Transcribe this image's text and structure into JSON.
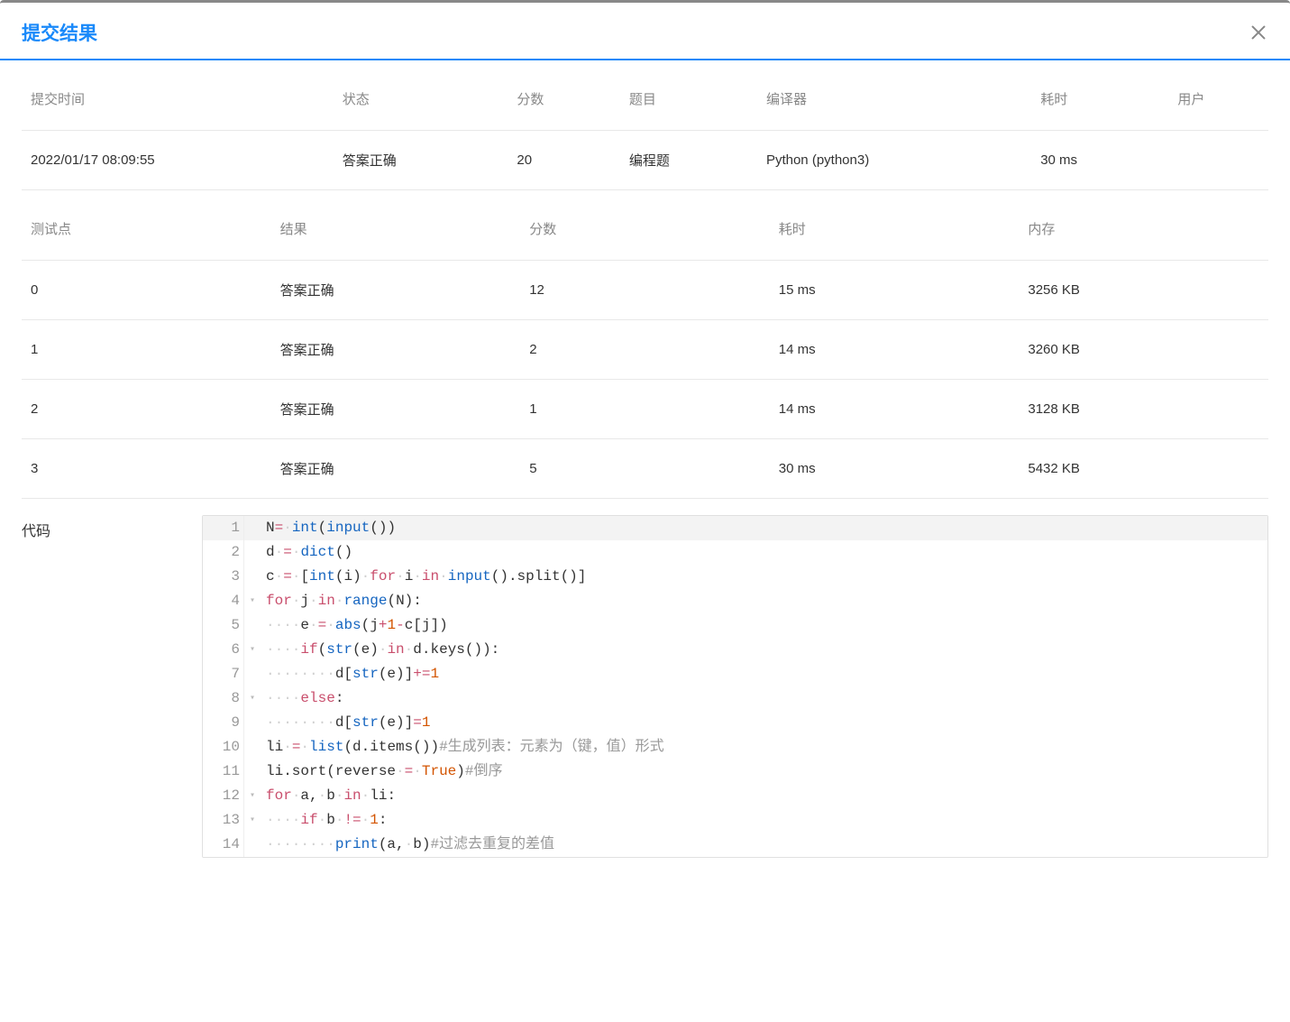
{
  "modal": {
    "title": "提交结果",
    "close_label": "关闭"
  },
  "summary_table": {
    "headers": {
      "submit_time": "提交时间",
      "status": "状态",
      "score": "分数",
      "problem": "题目",
      "compiler": "编译器",
      "time": "耗时",
      "user": "用户"
    },
    "row": {
      "submit_time": "2022/01/17 08:09:55",
      "status": "答案正确",
      "score": "20",
      "problem": "编程题",
      "compiler": "Python (python3)",
      "time": "30 ms",
      "user": ""
    }
  },
  "testpoint_table": {
    "headers": {
      "testpoint": "测试点",
      "result": "结果",
      "score": "分数",
      "time": "耗时",
      "memory": "内存"
    },
    "rows": [
      {
        "testpoint": "0",
        "result": "答案正确",
        "score": "12",
        "time": "15 ms",
        "memory": "3256 KB"
      },
      {
        "testpoint": "1",
        "result": "答案正确",
        "score": "2",
        "time": "14 ms",
        "memory": "3260 KB"
      },
      {
        "testpoint": "2",
        "result": "答案正确",
        "score": "1",
        "time": "14 ms",
        "memory": "3128 KB"
      },
      {
        "testpoint": "3",
        "result": "答案正确",
        "score": "5",
        "time": "30 ms",
        "memory": "5432 KB"
      }
    ]
  },
  "code_section": {
    "label": "代码",
    "lines": [
      {
        "n": 1,
        "fold": "",
        "indent": 0,
        "tokens": [
          [
            "id",
            "N"
          ],
          [
            "op",
            "="
          ],
          [
            "ws",
            "·"
          ],
          [
            "fn",
            "int"
          ],
          [
            "id",
            "("
          ],
          [
            "fn",
            "input"
          ],
          [
            "id",
            "())"
          ]
        ]
      },
      {
        "n": 2,
        "fold": "",
        "indent": 0,
        "tokens": [
          [
            "id",
            "d"
          ],
          [
            "ws",
            "·"
          ],
          [
            "op",
            "="
          ],
          [
            "ws",
            "·"
          ],
          [
            "fn",
            "dict"
          ],
          [
            "id",
            "()"
          ]
        ]
      },
      {
        "n": 3,
        "fold": "",
        "indent": 0,
        "tokens": [
          [
            "id",
            "c"
          ],
          [
            "ws",
            "·"
          ],
          [
            "op",
            "="
          ],
          [
            "ws",
            "·"
          ],
          [
            "id",
            "["
          ],
          [
            "fn",
            "int"
          ],
          [
            "id",
            "(i)"
          ],
          [
            "ws",
            "·"
          ],
          [
            "kw",
            "for"
          ],
          [
            "ws",
            "·"
          ],
          [
            "id",
            "i"
          ],
          [
            "ws",
            "·"
          ],
          [
            "kw",
            "in"
          ],
          [
            "ws",
            "·"
          ],
          [
            "fn",
            "input"
          ],
          [
            "id",
            "().split()]"
          ]
        ]
      },
      {
        "n": 4,
        "fold": "▾",
        "indent": 0,
        "tokens": [
          [
            "kw",
            "for"
          ],
          [
            "ws",
            "·"
          ],
          [
            "id",
            "j"
          ],
          [
            "ws",
            "·"
          ],
          [
            "kw",
            "in"
          ],
          [
            "ws",
            "·"
          ],
          [
            "fn",
            "range"
          ],
          [
            "id",
            "(N):"
          ]
        ]
      },
      {
        "n": 5,
        "fold": "",
        "indent": 1,
        "tokens": [
          [
            "id",
            "e"
          ],
          [
            "ws",
            "·"
          ],
          [
            "op",
            "="
          ],
          [
            "ws",
            "·"
          ],
          [
            "fn",
            "abs"
          ],
          [
            "id",
            "(j"
          ],
          [
            "op",
            "+"
          ],
          [
            "num",
            "1"
          ],
          [
            "op",
            "-"
          ],
          [
            "id",
            "c[j])"
          ]
        ]
      },
      {
        "n": 6,
        "fold": "▾",
        "indent": 1,
        "tokens": [
          [
            "kw",
            "if"
          ],
          [
            "id",
            "("
          ],
          [
            "fn",
            "str"
          ],
          [
            "id",
            "(e)"
          ],
          [
            "ws",
            "·"
          ],
          [
            "kw",
            "in"
          ],
          [
            "ws",
            "·"
          ],
          [
            "id",
            "d.keys()):"
          ]
        ]
      },
      {
        "n": 7,
        "fold": "",
        "indent": 2,
        "tokens": [
          [
            "id",
            "d["
          ],
          [
            "fn",
            "str"
          ],
          [
            "id",
            "(e)]"
          ],
          [
            "op",
            "+="
          ],
          [
            "num",
            "1"
          ]
        ]
      },
      {
        "n": 8,
        "fold": "▾",
        "indent": 1,
        "tokens": [
          [
            "kw",
            "else"
          ],
          [
            "id",
            ":"
          ]
        ]
      },
      {
        "n": 9,
        "fold": "",
        "indent": 2,
        "tokens": [
          [
            "id",
            "d["
          ],
          [
            "fn",
            "str"
          ],
          [
            "id",
            "(e)]"
          ],
          [
            "op",
            "="
          ],
          [
            "num",
            "1"
          ]
        ]
      },
      {
        "n": 10,
        "fold": "",
        "indent": 0,
        "tokens": [
          [
            "id",
            "li"
          ],
          [
            "ws",
            "·"
          ],
          [
            "op",
            "="
          ],
          [
            "ws",
            "·"
          ],
          [
            "fn",
            "list"
          ],
          [
            "id",
            "(d.items())"
          ],
          [
            "cmt",
            "#生成列表：元素为（键，值）形式"
          ]
        ]
      },
      {
        "n": 11,
        "fold": "",
        "indent": 0,
        "tokens": [
          [
            "id",
            "li.sort(reverse"
          ],
          [
            "ws",
            "·"
          ],
          [
            "op",
            "="
          ],
          [
            "ws",
            "·"
          ],
          [
            "bool",
            "True"
          ],
          [
            "id",
            ")"
          ],
          [
            "cmt",
            "#倒序"
          ]
        ]
      },
      {
        "n": 12,
        "fold": "▾",
        "indent": 0,
        "tokens": [
          [
            "kw",
            "for"
          ],
          [
            "ws",
            "·"
          ],
          [
            "id",
            "a,"
          ],
          [
            "ws",
            "·"
          ],
          [
            "id",
            "b"
          ],
          [
            "ws",
            "·"
          ],
          [
            "kw",
            "in"
          ],
          [
            "ws",
            "·"
          ],
          [
            "id",
            "li:"
          ]
        ]
      },
      {
        "n": 13,
        "fold": "▾",
        "indent": 1,
        "tokens": [
          [
            "kw",
            "if"
          ],
          [
            "ws",
            "·"
          ],
          [
            "id",
            "b"
          ],
          [
            "ws",
            "·"
          ],
          [
            "op",
            "!="
          ],
          [
            "ws",
            "·"
          ],
          [
            "num",
            "1"
          ],
          [
            "id",
            ":"
          ]
        ]
      },
      {
        "n": 14,
        "fold": "",
        "indent": 2,
        "tokens": [
          [
            "fn",
            "print"
          ],
          [
            "id",
            "(a,"
          ],
          [
            "ws",
            "·"
          ],
          [
            "id",
            "b)"
          ],
          [
            "cmt",
            "#过滤去重复的差值"
          ]
        ]
      }
    ]
  }
}
